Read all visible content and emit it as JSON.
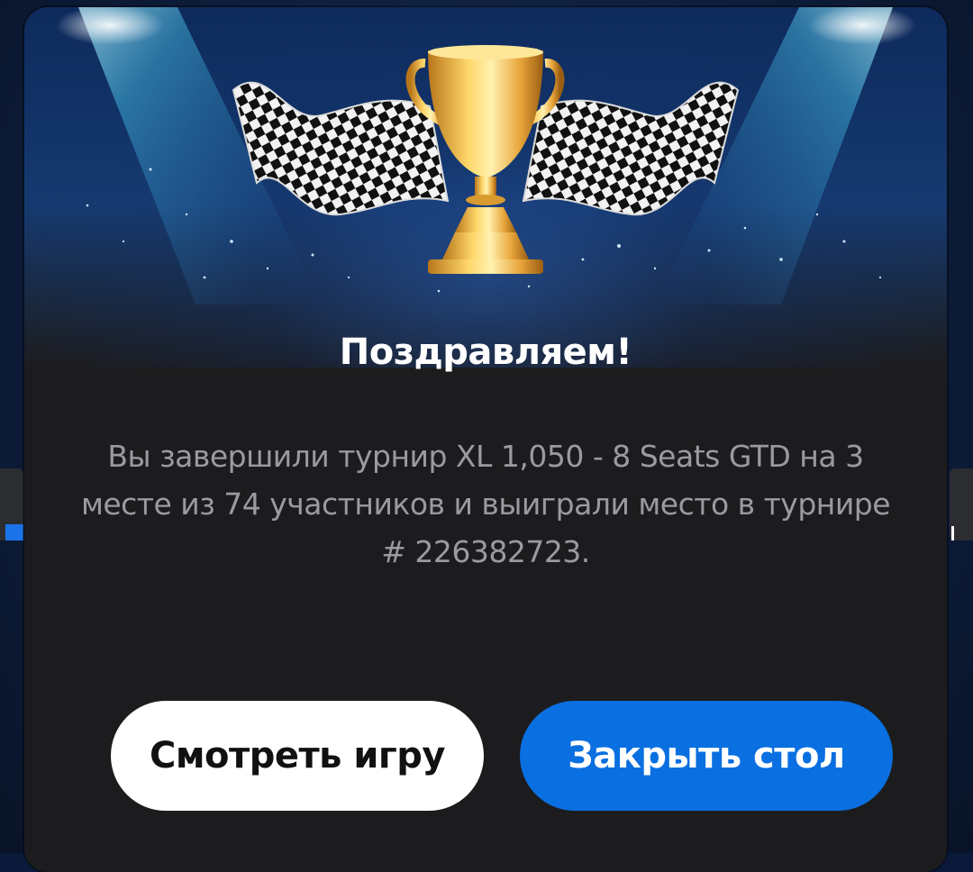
{
  "dialog": {
    "title": "Поздравляем!",
    "message": "Вы завершили турнир XL 1,050 - 8 Seats GTD на 3 месте из 74 участников и выиграли место в турнире # 226382723.",
    "buttons": {
      "watch_label": "Смотреть игру",
      "close_label": "Закрыть стол"
    },
    "hero_icons": [
      "trophy-icon",
      "checkered-flag-icon"
    ]
  },
  "colors": {
    "dialog_bg": "#1c1c1e",
    "primary_button": "#0a6fe0",
    "secondary_button": "#ffffff",
    "message_text": "#9a9aa0",
    "trophy_gold": "#e8b23a"
  }
}
